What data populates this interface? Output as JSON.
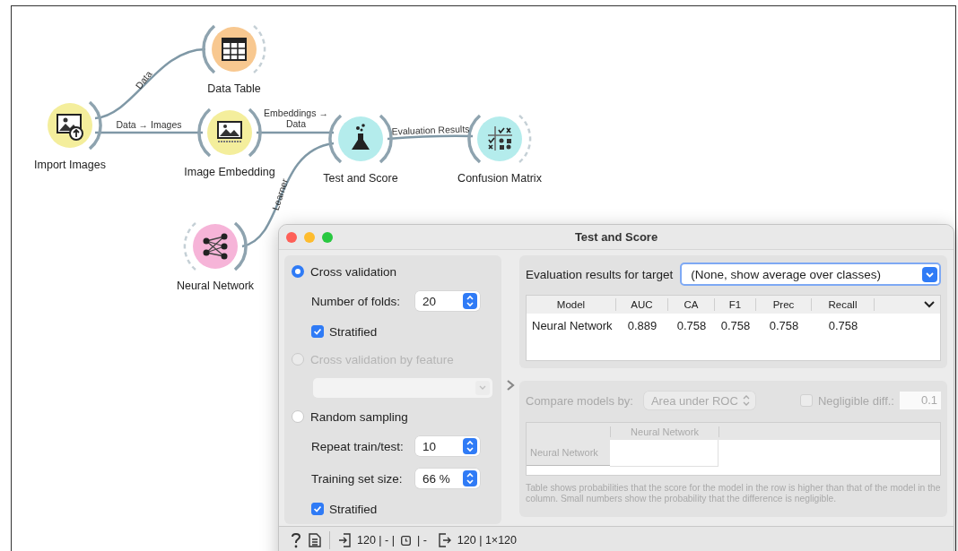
{
  "canvas": {
    "nodes": [
      {
        "label": "Import Images",
        "color": "#f4ee9c",
        "kind": "import"
      },
      {
        "label": "Data Table",
        "color": "#f8c890",
        "kind": "table"
      },
      {
        "label": "Image Embedding",
        "color": "#f4ee9c",
        "kind": "embedding"
      },
      {
        "label": "Test and Score",
        "color": "#b4ecec",
        "kind": "flask"
      },
      {
        "label": "Confusion Matrix",
        "color": "#b4ecec",
        "kind": "matrix"
      },
      {
        "label": "Neural Network",
        "color": "#f6b4d8",
        "kind": "network"
      }
    ],
    "links": [
      {
        "label": "Data"
      },
      {
        "label": "Data → Images"
      },
      {
        "label": "Embeddings → Data"
      },
      {
        "label": "Evaluation Results"
      },
      {
        "label": "Learner"
      }
    ]
  },
  "window": {
    "title": "Test and Score",
    "sampling": [
      {
        "kind": "radio",
        "label": "Cross validation",
        "selected": true,
        "disabled": false
      },
      {
        "kind": "spin",
        "label": "Number of folds:",
        "value": "20"
      },
      {
        "kind": "check",
        "label": "Stratified",
        "checked": true
      },
      {
        "kind": "radio",
        "label": "Cross validation by feature",
        "selected": false,
        "disabled": true
      },
      {
        "kind": "combo",
        "disabled": true
      },
      {
        "kind": "radio",
        "label": "Random sampling",
        "selected": false,
        "disabled": false
      },
      {
        "kind": "spin",
        "label": "Repeat train/test:",
        "value": "10"
      },
      {
        "kind": "spin",
        "label": "Training set size:",
        "value": "66 %"
      },
      {
        "kind": "check",
        "label": "Stratified",
        "checked": true
      }
    ],
    "target": {
      "label": "Evaluation results for target",
      "value": "(None, show average over classes)"
    },
    "results": {
      "columns": [
        "Model",
        "AUC",
        "CA",
        "F1",
        "Prec",
        "Recall"
      ],
      "rows": [
        [
          "Neural Network",
          "0.889",
          "0.758",
          "0.758",
          "0.758",
          "0.758"
        ]
      ]
    },
    "comparison": {
      "disabled": true,
      "label": "Compare models by:",
      "value": "Area under ROC",
      "negligible": {
        "label": "Negligible diff.:",
        "checked": false,
        "value": "0.1"
      },
      "columns": [
        "Neural Network"
      ],
      "rows": [
        "Neural Network"
      ],
      "note": "Table shows probabilities that the score for the model in the row is higher than that of the model in the column. Small numbers show the probability that the difference is negligible."
    },
    "status": {
      "input_count": "120 | - |",
      "input_rest": "| -",
      "output": "120 | 1×120"
    }
  }
}
